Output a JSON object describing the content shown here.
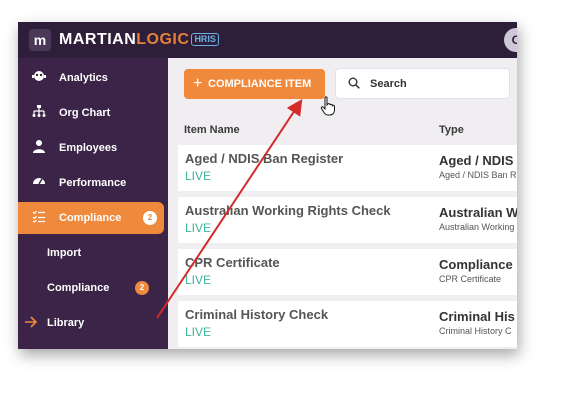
{
  "app": {
    "logo_glyph": "m",
    "brand_main": "MARTIAN",
    "brand_accent": "LOGIC",
    "brand_tag": "HRIS",
    "user_initial": "C"
  },
  "sidebar": {
    "items": [
      {
        "label": "Analytics",
        "icon": "analytics-icon"
      },
      {
        "label": "Org Chart",
        "icon": "org-chart-icon"
      },
      {
        "label": "Employees",
        "icon": "employees-icon"
      },
      {
        "label": "Performance",
        "icon": "performance-icon"
      },
      {
        "label": "Compliance",
        "icon": "checklist-icon",
        "badge": "2",
        "active": true
      }
    ],
    "sub_items": [
      {
        "label": "Import"
      },
      {
        "label": "Compliance",
        "badge": "2"
      },
      {
        "label": "Library",
        "icon": "arrow-right-icon"
      }
    ]
  },
  "toolbar": {
    "add_label": "COMPLIANCE ITEM",
    "add_icon": "+",
    "search_placeholder": "Search"
  },
  "table": {
    "columns": [
      "Item Name",
      "Type"
    ],
    "rows": [
      {
        "name": "Aged / NDIS Ban Register",
        "status": "LIVE",
        "type": "Aged / NDIS",
        "type_sub": "Aged / NDIS Ban R"
      },
      {
        "name": "Australian Working Rights Check",
        "status": "LIVE",
        "type": "Australian W",
        "type_sub": "Australian Working"
      },
      {
        "name": "CPR Certificate",
        "status": "LIVE",
        "type": "Compliance",
        "type_sub": "CPR Certificate"
      },
      {
        "name": "Criminal History Check",
        "status": "LIVE",
        "type": "Criminal His",
        "type_sub": "Criminal History C"
      }
    ]
  },
  "colors": {
    "sidebar_bg": "#3b2447",
    "topbar_bg": "#2e1e3a",
    "accent": "#ef8a3c",
    "live_status": "#3fb39c",
    "annotation_arrow": "#d42a2a"
  }
}
